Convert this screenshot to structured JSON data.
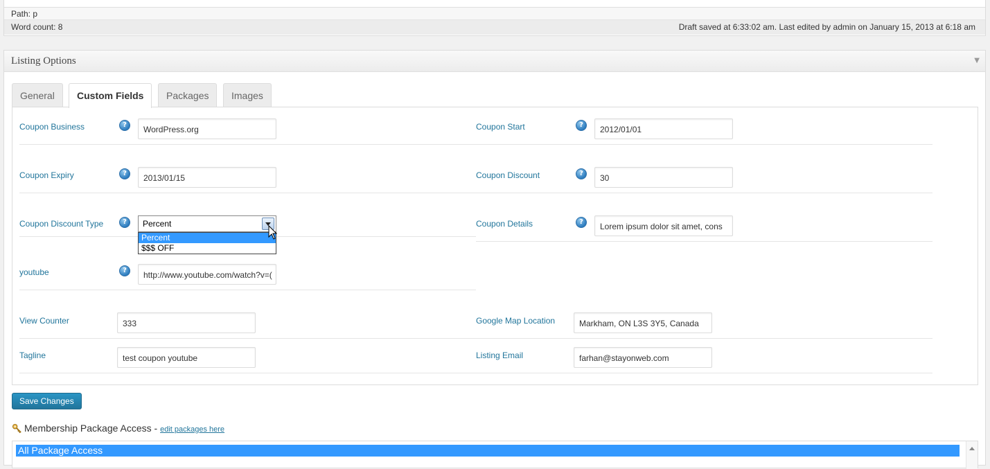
{
  "editor": {
    "path_text": "Path: p",
    "word_count": "Word count: 8",
    "draft_status": "Draft saved at 6:33:02 am. Last edited by admin on January 15, 2013 at 6:18 am"
  },
  "listing_options": {
    "title": "Listing Options",
    "toggle_icon": "triangle-down-icon",
    "tabs": [
      {
        "label": "General"
      },
      {
        "label": "Custom Fields",
        "active": true
      },
      {
        "label": "Packages"
      },
      {
        "label": "Images"
      }
    ],
    "fields": {
      "coupon_business": {
        "label": "Coupon Business",
        "value": "WordPress.org"
      },
      "coupon_start": {
        "label": "Coupon Start",
        "value": "2012/01/01"
      },
      "coupon_expiry": {
        "label": "Coupon Expiry",
        "value": "2013/01/15"
      },
      "coupon_discount": {
        "label": "Coupon Discount",
        "value": "30"
      },
      "coupon_discount_type": {
        "label": "Coupon Discount Type",
        "value": "Percent",
        "options": [
          "Percent",
          "$$$ OFF"
        ]
      },
      "coupon_details": {
        "label": "Coupon Details",
        "value": "Lorem ipsum dolor sit amet, cons"
      },
      "youtube": {
        "label": "youtube",
        "value": "http://www.youtube.com/watch?v=("
      },
      "view_counter": {
        "label": "View Counter",
        "value": "333"
      },
      "google_map_location": {
        "label": "Google Map Location",
        "value": "Markham, ON L3S 3Y5, Canada"
      },
      "tagline": {
        "label": "Tagline",
        "value": "test coupon youtube"
      },
      "listing_email": {
        "label": "Listing Email",
        "value": "farhan@stayonweb.com"
      }
    },
    "help_glyph": "?",
    "save_label": "Save Changes"
  },
  "membership": {
    "title": "Membership Package Access",
    "separator": " - ",
    "edit_link": "edit packages here",
    "items": [
      "All Package Access"
    ]
  },
  "colors": {
    "link": "#21759b",
    "selected": "#3399ff",
    "button": "#21759b"
  }
}
